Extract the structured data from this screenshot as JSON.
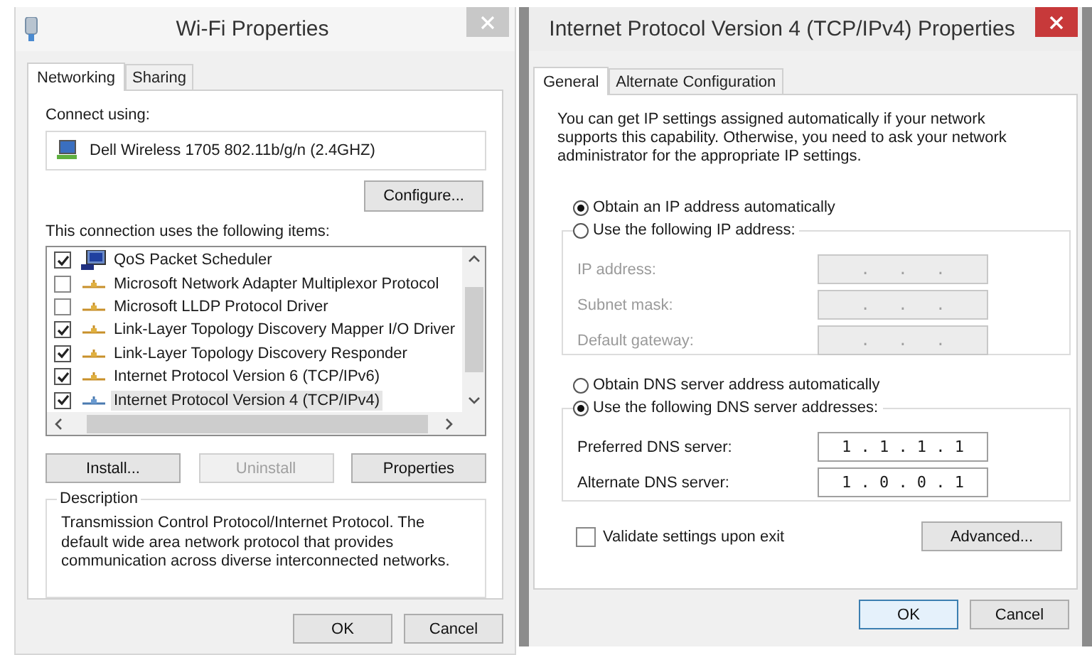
{
  "wifi_window": {
    "title": "Wi-Fi Properties",
    "tabs": [
      {
        "label": "Networking",
        "selected": true
      },
      {
        "label": "Sharing",
        "selected": false
      }
    ],
    "connect_using_label": "Connect using:",
    "adapter": "Dell Wireless 1705 802.11b/g/n (2.4GHZ)",
    "configure_button": "Configure...",
    "items_label": "This connection uses the following items:",
    "items": [
      {
        "label": "QoS Packet Scheduler",
        "kind": "scheduler",
        "checked": true,
        "selected": false
      },
      {
        "label": "Microsoft Network Adapter Multiplexor Protocol",
        "kind": "protocol",
        "checked": false,
        "selected": false
      },
      {
        "label": "Microsoft LLDP Protocol Driver",
        "kind": "protocol",
        "checked": false,
        "selected": false
      },
      {
        "label": "Link-Layer Topology Discovery Mapper I/O Driver",
        "kind": "protocol",
        "checked": true,
        "selected": false
      },
      {
        "label": "Link-Layer Topology Discovery Responder",
        "kind": "protocol",
        "checked": true,
        "selected": false
      },
      {
        "label": "Internet Protocol Version 6 (TCP/IPv6)",
        "kind": "protocol",
        "checked": true,
        "selected": false
      },
      {
        "label": "Internet Protocol Version 4 (TCP/IPv4)",
        "kind": "protocol",
        "checked": true,
        "selected": true
      }
    ],
    "item_buttons": [
      {
        "label": "Install...",
        "disabled": false
      },
      {
        "label": "Uninstall",
        "disabled": true
      },
      {
        "label": "Properties",
        "disabled": false
      }
    ],
    "description_title": "Description",
    "description": "Transmission Control Protocol/Internet Protocol. The default wide area network protocol that provides communication across diverse interconnected networks.",
    "dialog_buttons": [
      {
        "label": "OK",
        "default": false
      },
      {
        "label": "Cancel",
        "default": false
      }
    ]
  },
  "ipv4_window": {
    "title": "Internet Protocol Version 4 (TCP/IPv4) Properties",
    "tabs": [
      {
        "label": "General",
        "selected": true
      },
      {
        "label": "Alternate Configuration",
        "selected": false
      }
    ],
    "intro": "You can get IP settings assigned automatically if your network supports this capability. Otherwise, you need to ask your network administrator for the appropriate IP settings.",
    "ip_options": [
      {
        "label": "Obtain an IP address automatically",
        "selected": true
      },
      {
        "label": "Use the following IP address:",
        "selected": false
      }
    ],
    "ip_fields": [
      {
        "label": "IP address:",
        "value": ".   .   .",
        "disabled": true
      },
      {
        "label": "Subnet mask:",
        "value": ".   .   .",
        "disabled": true
      },
      {
        "label": "Default gateway:",
        "value": ".   .   .",
        "disabled": true
      }
    ],
    "dns_options": [
      {
        "label": "Obtain DNS server address automatically",
        "selected": false
      },
      {
        "label": "Use the following DNS server addresses:",
        "selected": true
      }
    ],
    "dns_fields": [
      {
        "label": "Preferred DNS server:",
        "value": "1 . 1 . 1 . 1",
        "disabled": false
      },
      {
        "label": "Alternate DNS server:",
        "value": "1 . 0 . 0 . 1",
        "disabled": false
      }
    ],
    "validate": {
      "label": "Validate settings upon exit",
      "checked": false
    },
    "advanced_button": "Advanced...",
    "dialog_buttons": [
      {
        "label": "OK",
        "default": true
      },
      {
        "label": "Cancel",
        "default": false
      }
    ]
  }
}
